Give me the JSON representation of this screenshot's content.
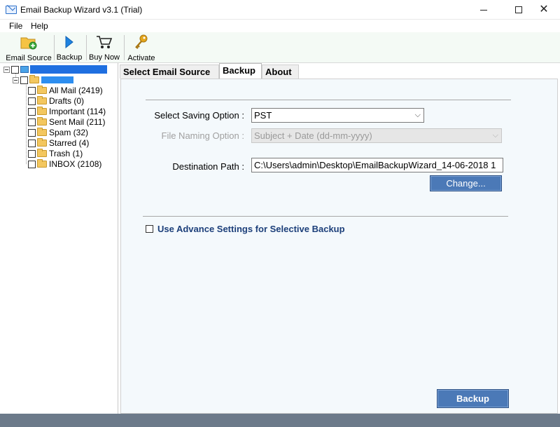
{
  "window": {
    "title": "Email Backup Wizard v3.1 (Trial)"
  },
  "menu": [
    "File",
    "Help"
  ],
  "toolbar": {
    "email_source": "Email Source",
    "backup": "Backup",
    "buy_now": "Buy Now",
    "activate": "Activate"
  },
  "tree": {
    "folders": [
      {
        "label": "All Mail (2419)"
      },
      {
        "label": "Drafts (0)"
      },
      {
        "label": "Important (114)"
      },
      {
        "label": "Sent Mail (211)"
      },
      {
        "label": "Spam (32)"
      },
      {
        "label": "Starred (4)"
      },
      {
        "label": "Trash (1)"
      },
      {
        "label": "INBOX (2108)"
      }
    ]
  },
  "tabs": [
    "Select Email Source",
    "Backup",
    "About"
  ],
  "form": {
    "saving_label": "Select Saving Option :",
    "saving_value": "PST",
    "naming_label": "File Naming Option :",
    "naming_value": "Subject + Date (dd-mm-yyyy)",
    "dest_label": "Destination Path :",
    "dest_value": "C:\\Users\\admin\\Desktop\\EmailBackupWizard_14-06-2018 1",
    "change_label": "Change...",
    "advance_label": "Use Advance Settings for Selective Backup",
    "backup_label": "Backup"
  },
  "colors": {
    "accent": "#4b79b7",
    "toolbar_bg": "#f4faf5",
    "content_bg": "#f4f9fc",
    "status_bar": "#6c7a8a",
    "advance_text": "#1c3f7a"
  }
}
